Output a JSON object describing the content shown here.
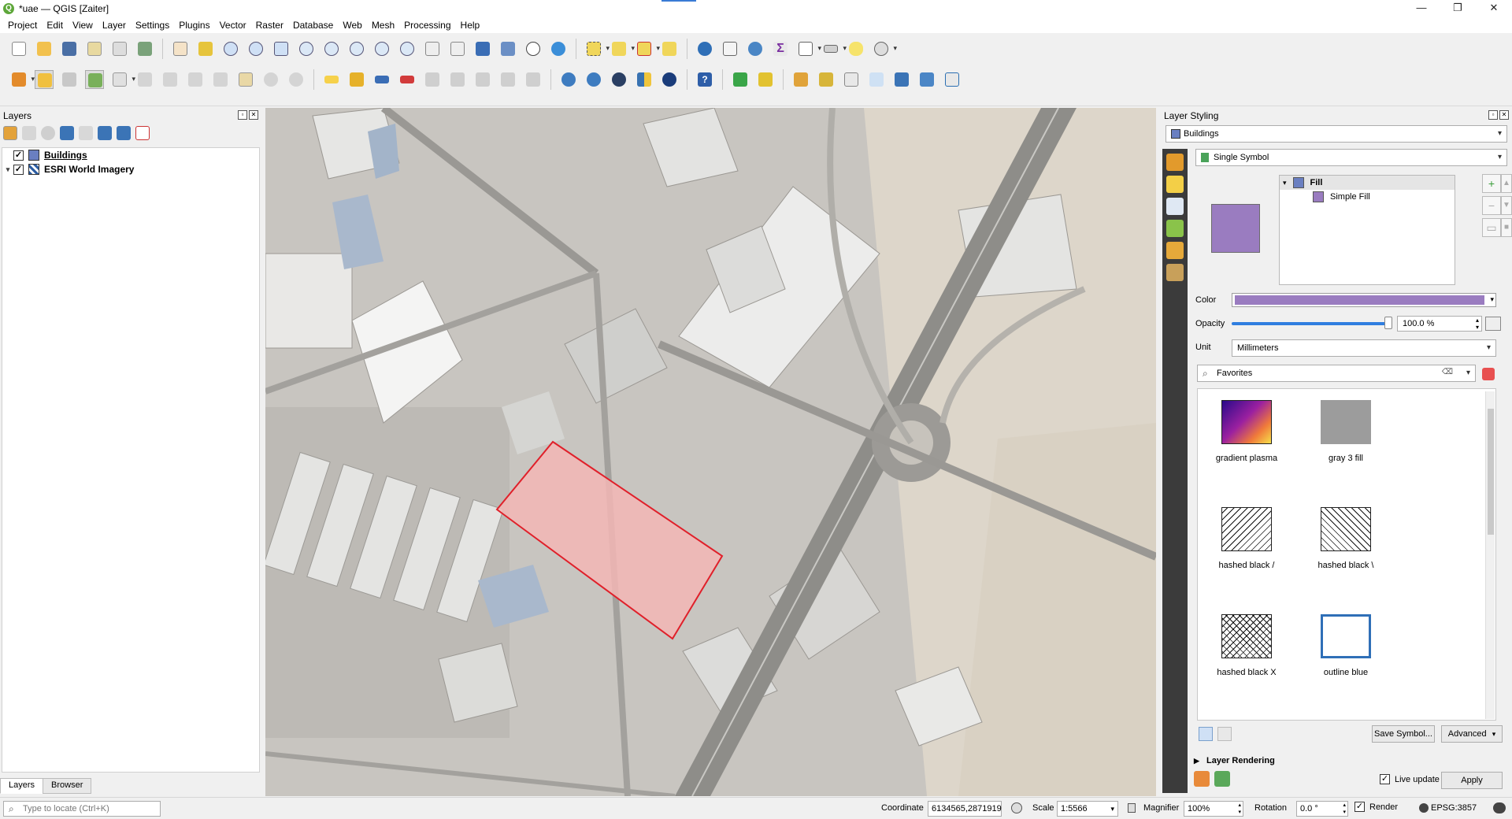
{
  "window": {
    "title": "*uae — QGIS [Zaiter]",
    "controls": [
      "—",
      "❐",
      "✕"
    ]
  },
  "menubar": [
    "Project",
    "Edit",
    "View",
    "Layer",
    "Settings",
    "Plugins",
    "Vector",
    "Raster",
    "Database",
    "Web",
    "Mesh",
    "Processing",
    "Help"
  ],
  "layers_panel": {
    "title": "Layers",
    "layers": [
      {
        "name": "Buildings",
        "checked": true,
        "icon": "polygon-layer-icon"
      },
      {
        "name": "ESRI World Imagery",
        "checked": true,
        "icon": "raster-layer-icon"
      }
    ],
    "tabs": [
      "Layers",
      "Browser"
    ]
  },
  "styling_panel": {
    "title": "Layer Styling",
    "layer_select": "Buildings",
    "renderer": "Single Symbol",
    "symbol_tree": {
      "root": "Fill",
      "child": "Simple Fill"
    },
    "fill_color": "#9a7cc0",
    "color_label": "Color",
    "opacity_label": "Opacity",
    "opacity_value": "100.0 %",
    "opacity_fraction": 1.0,
    "unit_label": "Unit",
    "unit_value": "Millimeters",
    "favorites_placeholder": "Favorites",
    "gallery": [
      {
        "label": "gradient  plasma",
        "kind": "gradient"
      },
      {
        "label": "gray 3 fill",
        "kind": "gray"
      },
      {
        "label": "hashed black /",
        "kind": "hash-fwd"
      },
      {
        "label": "hashed black \\",
        "kind": "hash-back"
      },
      {
        "label": "hashed black X",
        "kind": "hash-x"
      },
      {
        "label": "outline blue",
        "kind": "outline"
      }
    ],
    "save_symbol": "Save Symbol...",
    "advanced": "Advanced",
    "layer_rendering": "Layer Rendering",
    "live_update": "Live update",
    "apply": "Apply"
  },
  "statusbar": {
    "locator_placeholder": "Type to locate (Ctrl+K)",
    "coordinate_label": "Coordinate",
    "coordinate": "6134565,2871919",
    "scale_label": "Scale",
    "scale": "1:5566",
    "magnifier_label": "Magnifier",
    "magnifier": "100%",
    "rotation_label": "Rotation",
    "rotation": "0.0 °",
    "render_label": "Render",
    "crs": "EPSG:3857"
  }
}
